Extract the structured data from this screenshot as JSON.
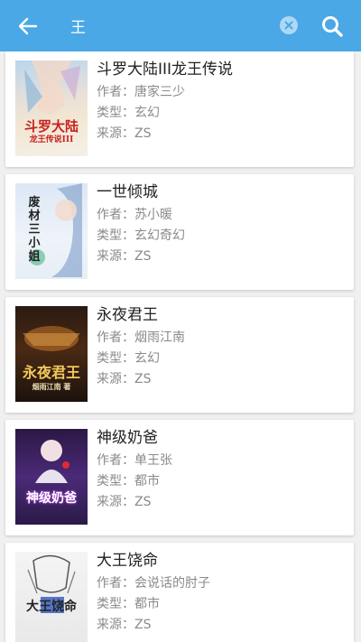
{
  "search": {
    "query": "王"
  },
  "colors": {
    "toolbar": "#4aa8e6",
    "background": "#f0f0f0",
    "title": "#222222",
    "meta": "#8a8a8a"
  },
  "icons": {
    "back": "arrow-left-icon",
    "clear": "clear-x-icon",
    "search": "magnifier-icon"
  },
  "books": [
    {
      "title": "斗罗大陆III龙王传说",
      "author": "作者：唐家三少",
      "genre": "类型：玄幻",
      "source": "来源：ZS",
      "cover_text": "斗罗大陆",
      "cover_sub": "龙王传说III"
    },
    {
      "title": "一世倾城",
      "author": "作者：苏小暖",
      "genre": "类型：玄幻奇幻",
      "source": "来源：ZS",
      "cover_text": "废材三小姐",
      "cover_sub": ""
    },
    {
      "title": "永夜君王",
      "author": "作者：烟雨江南",
      "genre": "类型：玄幻",
      "source": "来源：ZS",
      "cover_text": "永夜君王",
      "cover_sub": "烟雨江南 著"
    },
    {
      "title": "神级奶爸",
      "author": "作者：单王张",
      "genre": "类型：都市",
      "source": "来源：ZS",
      "cover_text": "神级奶爸",
      "cover_sub": ""
    },
    {
      "title": "大王饶命",
      "author": "作者：会说话的肘子",
      "genre": "类型：都市",
      "source": "来源：ZS",
      "cover_text": "大王饶命",
      "cover_sub": ""
    }
  ]
}
